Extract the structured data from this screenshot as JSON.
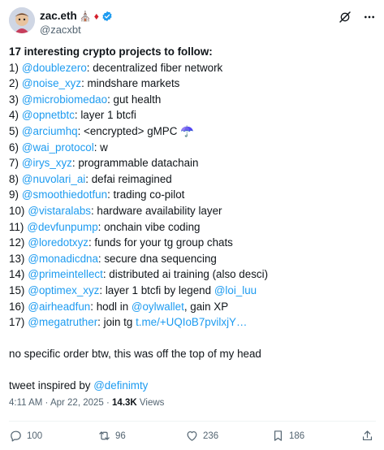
{
  "author": {
    "name": "zac.eth",
    "handle": "@zacxbt",
    "name_emojis": [
      "⛪",
      "♦"
    ]
  },
  "tweet": {
    "title": "17 interesting crypto projects to follow:",
    "items": [
      {
        "num": "1)",
        "mention": "@doublezero",
        "text": ": decentralized fiber network"
      },
      {
        "num": "2)",
        "mention": "@noise_xyz",
        "text": ": mindshare markets"
      },
      {
        "num": "3)",
        "mention": "@microbiomedao",
        "text": ": gut health"
      },
      {
        "num": "4)",
        "mention": "@opnetbtc",
        "text": ": layer 1 btcfi"
      },
      {
        "num": "5)",
        "mention": "@arciumhq",
        "text": ": <encrypted> gMPC ☂️"
      },
      {
        "num": "6)",
        "mention": "@wai_protocol",
        "text": ": w"
      },
      {
        "num": "7)",
        "mention": "@irys_xyz",
        "text": ": programmable datachain"
      },
      {
        "num": "8)",
        "mention": "@nuvolari_ai",
        "text": ": defai reimagined"
      },
      {
        "num": "9)",
        "mention": "@smoothiedotfun",
        "text": ": trading co-pilot"
      },
      {
        "num": "10)",
        "mention": "@vistaralabs",
        "text": ": hardware availability layer"
      },
      {
        "num": "11)",
        "mention": "@devfunpump",
        "text": ": onchain vibe coding"
      },
      {
        "num": "12)",
        "mention": "@loredotxyz",
        "text": ": funds for your tg group chats"
      },
      {
        "num": "13)",
        "mention": "@monadicdna",
        "text": ": secure dna sequencing"
      },
      {
        "num": "14)",
        "mention": "@primeintellect",
        "text": ": distributed ai training (also desci)"
      },
      {
        "num": "15)",
        "mention": "@optimex_xyz",
        "text": ": layer 1 btcfi by legend ",
        "mention2": "@loi_luu"
      },
      {
        "num": "16)",
        "mention": "@airheadfun",
        "text": ": hodl in ",
        "mention2": "@oylwallet",
        "text2": ", gain XP"
      },
      {
        "num": "17)",
        "mention": "@megatruther",
        "text": ": join tg ",
        "mention2": "t.me/+UQIoB7pvilxjY…"
      }
    ],
    "note": "no specific order btw, this was off the top of my head",
    "inspired_prefix": "tweet inspired by ",
    "inspired_mention": "@definimty"
  },
  "meta": {
    "time": "4:11 AM",
    "sep": " · ",
    "date": "Apr 22, 2025",
    "views_count": "14.3K",
    "views_label": "Views"
  },
  "stats": {
    "replies": "100",
    "reposts": "96",
    "likes": "236",
    "bookmarks": "186"
  },
  "icons": {
    "verified": "verified-badge-icon",
    "grok": "grok-icon",
    "more": "more-icon",
    "reply": "reply-icon",
    "repost": "repost-icon",
    "like": "like-icon",
    "bookmark": "bookmark-icon",
    "share": "share-icon"
  },
  "colors": {
    "link": "#1d9bf0",
    "secondary": "#536471",
    "text": "#0f1419"
  }
}
